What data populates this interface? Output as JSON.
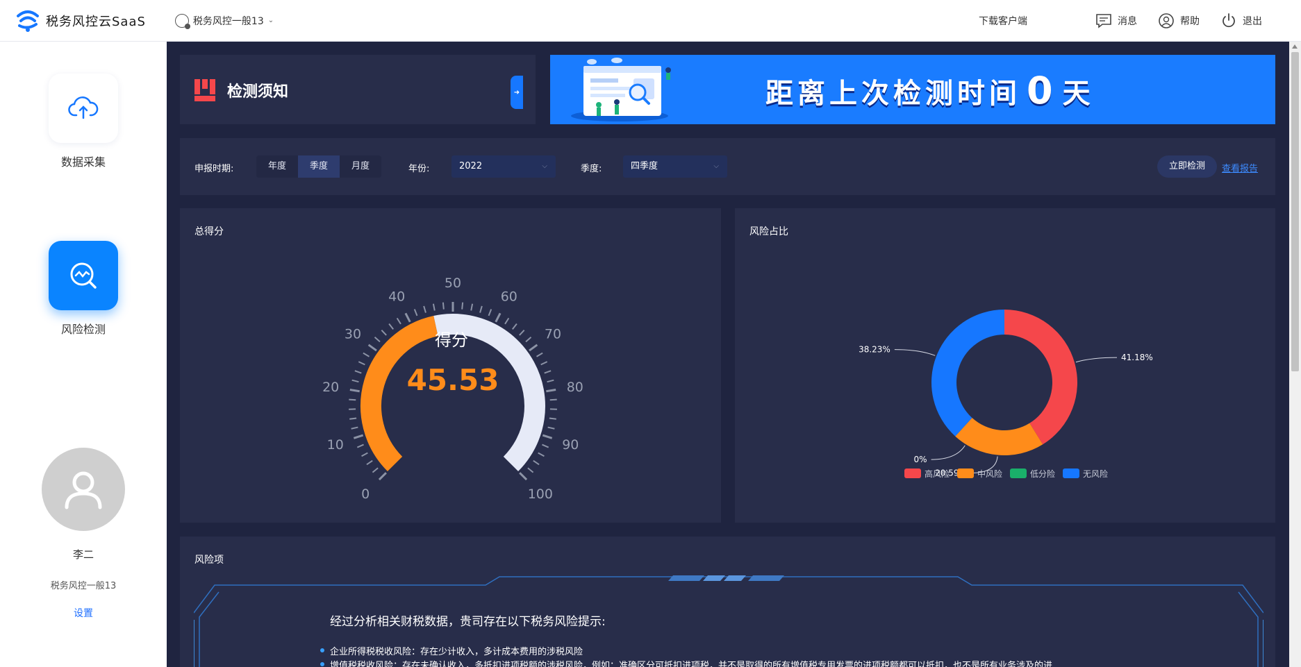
{
  "app": {
    "title": "税务风控云SaaS",
    "company_selector": "税务风控一般13"
  },
  "topbar": {
    "download": "下载客户端",
    "message": "消息",
    "help": "帮助",
    "logout": "退出"
  },
  "sidebar": {
    "items": [
      {
        "label": "数据采集",
        "icon": "cloud-upload-icon",
        "active": false
      },
      {
        "label": "风险检测",
        "icon": "risk-scan-icon",
        "active": true
      }
    ],
    "user": {
      "name": "李二",
      "company": "税务风控一般13",
      "settings": "设置"
    }
  },
  "notice": {
    "title": "检测须知",
    "banner_prefix": "距离上次检测时间",
    "banner_days": "0",
    "banner_suffix": "天"
  },
  "filter": {
    "period_label": "申报时期:",
    "period_options": [
      "年度",
      "季度",
      "月度"
    ],
    "period_selected": "季度",
    "year_label": "年份:",
    "year_value": "2022",
    "quarter_label": "季度:",
    "quarter_value": "四季度",
    "detect_button": "立即检测",
    "report_link": "查看报告"
  },
  "score_panel": {
    "title": "总得分",
    "score_label": "得分",
    "score_value": "45.53",
    "colors": {
      "filled": "#ff8c1a",
      "rest": "#e6eaf7"
    }
  },
  "ratio_panel": {
    "title": "风险占比"
  },
  "chart_data": [
    {
      "type": "gauge",
      "min": 0,
      "max": 100,
      "value": 45.53,
      "tick_labels": [
        "0",
        "10",
        "20",
        "30",
        "40",
        "50",
        "60",
        "70",
        "80",
        "90",
        "100"
      ],
      "center_label": "得分",
      "value_label": "45.53"
    },
    {
      "type": "pie",
      "donut": true,
      "categories": [
        "高风险",
        "中风险",
        "低分险",
        "无风险"
      ],
      "values": [
        41.18,
        20.59,
        0,
        38.23
      ],
      "labels": [
        "41.18%",
        "20.59%",
        "0%",
        "38.23%"
      ],
      "colors": [
        "#f5474b",
        "#ff8c1a",
        "#1aaf6a",
        "#1677ff"
      ],
      "legend": "bottom"
    }
  ],
  "risk_panel": {
    "title": "风险项",
    "heading": "经过分析相关财税数据，贵司存在以下税务风险提示:",
    "items": [
      "企业所得税税收风险：存在少计收入，多计成本费用的涉税风险",
      "增值税税收风险：存在未确认收入，多抵扣进项税额的涉税风险，例如：准确区分可抵扣进项税，并不是取得的所有增值税专用发票的进项税额都可以抵扣，也不是所有业务涉及的进"
    ]
  }
}
